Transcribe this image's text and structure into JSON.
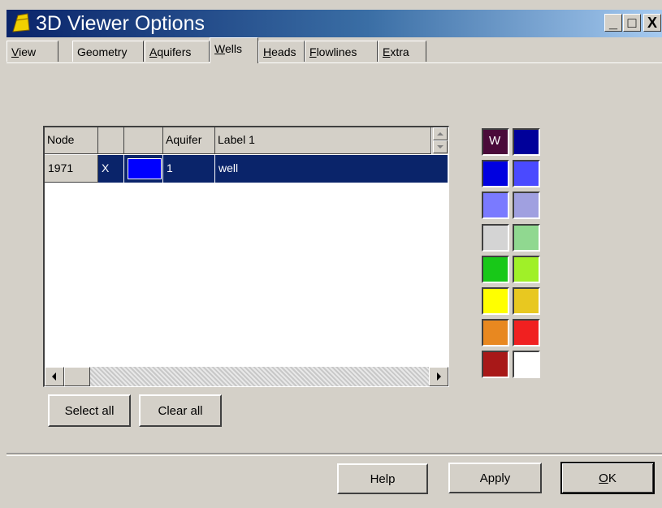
{
  "window": {
    "title": "3D Viewer Options",
    "controls": {
      "minimize": "_",
      "maximize": "□",
      "close": "X"
    }
  },
  "tabs": [
    {
      "label": "View",
      "underline": "V"
    },
    {
      "label": "Geometry",
      "underline": ""
    },
    {
      "label": "Aquifers",
      "underline": "A"
    },
    {
      "label": "Wells",
      "underline": "W",
      "active": true
    },
    {
      "label": "Heads",
      "underline": "H"
    },
    {
      "label": "Flowlines",
      "underline": "F"
    },
    {
      "label": "Extra",
      "underline": "E"
    }
  ],
  "grid": {
    "columns": [
      "Node",
      "",
      "",
      "Aquifer",
      "Label 1"
    ],
    "rows": [
      {
        "node": "1971",
        "flag": "X",
        "color": "#0000ff",
        "aquifer": "1",
        "label": "well"
      }
    ]
  },
  "buttons": {
    "select_all": "Select all",
    "clear_all": "Clear all",
    "help": "Help",
    "apply": "Apply",
    "ok": "OK"
  },
  "palette": {
    "selected_label": "W",
    "colors": [
      "#4a0a3a",
      "#00009a",
      "#0000e0",
      "#4a4aff",
      "#7a7aff",
      "#a0a0e0",
      "#d4d4d4",
      "#90d890",
      "#18c818",
      "#a0f028",
      "#ffff00",
      "#e8c820",
      "#e88820",
      "#f02020",
      "#a81818",
      "#ffffff"
    ]
  }
}
